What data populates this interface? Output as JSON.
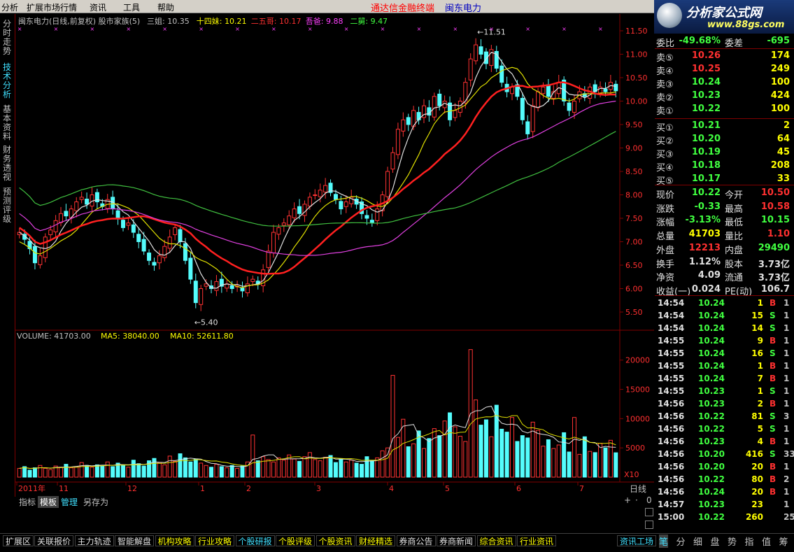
{
  "menu": {
    "items": [
      "分析",
      "扩展市场行情",
      "资讯",
      "工具",
      "帮助"
    ],
    "title": "通达信金融终端",
    "stock": "闽东电力"
  },
  "logo": {
    "main": "分析家公式网",
    "url": "www.88gs.com"
  },
  "side_tabs": [
    "分时走势",
    "技术分析",
    "基本资料",
    "财务透视",
    "预测评级"
  ],
  "chart_header": {
    "name": "闽东电力(日线,前复权) 股市家族(5)",
    "indicators": [
      {
        "label": "三姐: 10.35",
        "color": "#c0c0c0"
      },
      {
        "label": "十四妹: 10.21",
        "color": "#ffff00"
      },
      {
        "label": "二五哥: 10.17",
        "color": "#ff3030"
      },
      {
        "label": "吾爸: 9.88",
        "color": "#ff40ff"
      },
      {
        "label": "二舅: 9.47",
        "color": "#40ff40"
      }
    ]
  },
  "colors": {
    "up": "#ff3232",
    "down": "#54fcfc",
    "ma_white": "#e0e0e0",
    "ma_yellow": "#e0e000",
    "ma_red": "#ff2020",
    "ma_magenta": "#e040e0",
    "ma_green": "#40c040",
    "axis": "#800000"
  },
  "chart_data": {
    "type": "candlestick",
    "price_axis": {
      "ticks": [
        "11.50",
        "11.00",
        "10.50",
        "10.00",
        "9.50",
        "9.00",
        "8.50",
        "8.00",
        "7.50",
        "7.00",
        "6.50",
        "6.00",
        "5.50"
      ],
      "min": 5.5,
      "max": 11.5
    },
    "annotations": {
      "high": "11.51",
      "low": "5.40"
    },
    "x_labels": [
      "2011年",
      "11",
      "12",
      "1",
      "2",
      "3",
      "4",
      "5",
      "6",
      "7"
    ],
    "volume_header": [
      {
        "label": "VOLUME: 41703.00",
        "color": "#c0c0c0"
      },
      {
        "label": "MA5: 38040.00",
        "color": "#ffff00"
      },
      {
        "label": "MA10: 52611.80",
        "color": "#ffff00"
      }
    ],
    "volume_axis": {
      "ticks": [
        "20000",
        "15000",
        "10000",
        "5000"
      ],
      "unit": "X10",
      "max": 22000
    },
    "closes": [
      7.2,
      7.05,
      6.85,
      6.55,
      6.7,
      7.1,
      7.25,
      7.45,
      7.6,
      7.55,
      7.7,
      7.85,
      7.95,
      7.8,
      8.0,
      7.85,
      7.75,
      7.9,
      7.7,
      7.5,
      7.3,
      7.4,
      7.2,
      7.0,
      6.8,
      6.6,
      6.5,
      6.7,
      6.9,
      7.1,
      7.3,
      7.0,
      6.6,
      6.2,
      5.7,
      6.0,
      6.1,
      6.0,
      6.15,
      6.05,
      6.1,
      6.0,
      6.05,
      5.95,
      6.1,
      6.2,
      6.1,
      6.4,
      6.8,
      7.2,
      7.3,
      7.4,
      7.55,
      7.7,
      7.6,
      7.8,
      7.95,
      8.0,
      8.1,
      8.2,
      8.05,
      7.9,
      7.7,
      7.85,
      7.95,
      7.8,
      7.6,
      7.5,
      7.4,
      7.7,
      8.0,
      8.5,
      8.9,
      9.4,
      9.6,
      9.5,
      9.8,
      9.6,
      9.9,
      9.7,
      10.1,
      9.9,
      10.0,
      9.6,
      9.8,
      10.0,
      10.4,
      10.9,
      11.2,
      11.0,
      10.8,
      11.1,
      10.7,
      10.4,
      10.2,
      10.3,
      10.1,
      9.6,
      9.3,
      9.9,
      10.2,
      10.3,
      10.1,
      10.2,
      10.4,
      10.0,
      9.8,
      10.0,
      10.2,
      10.1,
      10.3,
      10.2,
      10.3,
      10.2,
      10.4,
      10.22
    ],
    "volumes": [
      1500,
      1800,
      1200,
      1600,
      2000,
      1500,
      1300,
      1900,
      1700,
      2200,
      1600,
      1800,
      2500,
      2000,
      1700,
      2100,
      1900,
      2600,
      1800,
      2400,
      2000,
      1700,
      2900,
      2300,
      1900,
      2800,
      3200,
      2500,
      2100,
      3600,
      2700,
      4000,
      3300,
      2600,
      3100,
      2400,
      2000,
      1700,
      2200,
      1800,
      1600,
      2000,
      1500,
      1900,
      2600,
      7200,
      2800,
      3500,
      3000,
      2600,
      3300,
      2900,
      3800,
      3100,
      2700,
      3500,
      4200,
      3000,
      2800,
      3400,
      3700,
      2500,
      3100,
      2600,
      2900,
      2400,
      2200,
      3500,
      2800,
      3300,
      4500,
      5000,
      17400,
      6800,
      9900,
      5200,
      5700,
      7900,
      4900,
      6600,
      8300,
      7100,
      9600,
      11000,
      8600,
      7000,
      6100,
      21800,
      13200,
      8900,
      9800,
      6900,
      12300,
      8200,
      7700,
      10200,
      6100,
      7100,
      6700,
      9400,
      8000,
      5300,
      6400,
      4900,
      5500,
      7600,
      4300,
      10200,
      3900,
      6900,
      4400,
      4200,
      5800,
      5000,
      6300,
      4170
    ],
    "ma_lines": {
      "ma_white": {
        "start": 7.2,
        "end": 10.35
      },
      "ma_yellow": {
        "start": 7.0,
        "end": 10.21
      },
      "ma_red": {
        "start": 7.3,
        "end": 10.17
      },
      "ma_magenta": {
        "start": 7.6,
        "end": 9.88
      },
      "ma_green": {
        "start": 8.15,
        "end": 9.47
      }
    }
  },
  "quote": {
    "rows": [
      {
        "l": "委比",
        "v": "-49.68%",
        "l2": "委差",
        "v2": "-695",
        "vc": "#40ff40",
        "v2c": "#40ff40"
      },
      {
        "l": "卖⑤",
        "v": "10.26",
        "v2": "174",
        "vc": "#ff3030",
        "v2c": "#ffff00"
      },
      {
        "l": "卖④",
        "v": "10.25",
        "v2": "249",
        "vc": "#ff3030",
        "v2c": "#ffff00"
      },
      {
        "l": "卖③",
        "v": "10.24",
        "v2": "100",
        "vc": "#40ff40",
        "v2c": "#ffff00"
      },
      {
        "l": "卖②",
        "v": "10.23",
        "v2": "424",
        "vc": "#40ff40",
        "v2c": "#ffff00"
      },
      {
        "l": "卖①",
        "v": "10.22",
        "v2": "100",
        "vc": "#40ff40",
        "v2c": "#ffff00"
      },
      {
        "l": "买①",
        "v": "10.21",
        "v2": "2",
        "vc": "#40ff40",
        "v2c": "#ffff00"
      },
      {
        "l": "买②",
        "v": "10.20",
        "v2": "64",
        "vc": "#40ff40",
        "v2c": "#ffff00"
      },
      {
        "l": "买③",
        "v": "10.19",
        "v2": "45",
        "vc": "#40ff40",
        "v2c": "#ffff00"
      },
      {
        "l": "买④",
        "v": "10.18",
        "v2": "208",
        "vc": "#40ff40",
        "v2c": "#ffff00"
      },
      {
        "l": "买⑤",
        "v": "10.17",
        "v2": "33",
        "vc": "#40ff40",
        "v2c": "#ffff00"
      }
    ],
    "stats": [
      {
        "l": "现价",
        "v": "10.22",
        "l2": "今开",
        "v2": "10.50",
        "vc": "#40ff40",
        "v2c": "#ff3030"
      },
      {
        "l": "涨跌",
        "v": "-0.33",
        "l2": "最高",
        "v2": "10.58",
        "vc": "#40ff40",
        "v2c": "#ff3030"
      },
      {
        "l": "涨幅",
        "v": "-3.13%",
        "l2": "最低",
        "v2": "10.15",
        "vc": "#40ff40",
        "v2c": "#40ff40"
      },
      {
        "l": "总量",
        "v": "41703",
        "l2": "量比",
        "v2": "1.10",
        "vc": "#ffff00",
        "v2c": "#ff3030"
      },
      {
        "l": "外盘",
        "v": "12213",
        "l2": "内盘",
        "v2": "29490",
        "vc": "#ff3030",
        "v2c": "#40ff40"
      },
      {
        "l": "换手",
        "v": "1.12%",
        "l2": "股本",
        "v2": "3.73亿",
        "vc": "#e0e0e0",
        "v2c": "#e0e0e0"
      },
      {
        "l": "净资",
        "v": "4.09",
        "l2": "流通",
        "v2": "3.73亿",
        "vc": "#e0e0e0",
        "v2c": "#e0e0e0"
      },
      {
        "l": "收益(一)",
        "v": "0.024",
        "l2": "PE(动)",
        "v2": "106.7",
        "vc": "#e0e0e0",
        "v2c": "#e0e0e0"
      }
    ]
  },
  "trades": [
    {
      "t": "14:54",
      "p": "10.24",
      "q": "1",
      "bs": "B",
      "n": "1"
    },
    {
      "t": "14:54",
      "p": "10.24",
      "q": "15",
      "bs": "S",
      "n": "1"
    },
    {
      "t": "14:54",
      "p": "10.24",
      "q": "14",
      "bs": "S",
      "n": "1"
    },
    {
      "t": "14:55",
      "p": "10.24",
      "q": "9",
      "bs": "B",
      "n": "1"
    },
    {
      "t": "14:55",
      "p": "10.24",
      "q": "16",
      "bs": "S",
      "n": "1"
    },
    {
      "t": "14:55",
      "p": "10.24",
      "q": "1",
      "bs": "B",
      "n": "1"
    },
    {
      "t": "14:55",
      "p": "10.24",
      "q": "7",
      "bs": "B",
      "n": "1"
    },
    {
      "t": "14:55",
      "p": "10.23",
      "q": "1",
      "bs": "S",
      "n": "1"
    },
    {
      "t": "14:56",
      "p": "10.23",
      "q": "2",
      "bs": "B",
      "n": "1"
    },
    {
      "t": "14:56",
      "p": "10.22",
      "q": "81",
      "bs": "S",
      "n": "3"
    },
    {
      "t": "14:56",
      "p": "10.22",
      "q": "5",
      "bs": "S",
      "n": "1"
    },
    {
      "t": "14:56",
      "p": "10.23",
      "q": "4",
      "bs": "B",
      "n": "1"
    },
    {
      "t": "14:56",
      "p": "10.20",
      "q": "416",
      "bs": "S",
      "n": "33"
    },
    {
      "t": "14:56",
      "p": "10.20",
      "q": "20",
      "bs": "B",
      "n": "1"
    },
    {
      "t": "14:56",
      "p": "10.22",
      "q": "80",
      "bs": "B",
      "n": "2"
    },
    {
      "t": "14:56",
      "p": "10.24",
      "q": "20",
      "bs": "B",
      "n": "1"
    },
    {
      "t": "14:57",
      "p": "10.23",
      "q": "23",
      "bs": "",
      "n": "1"
    },
    {
      "t": "15:00",
      "p": "10.22",
      "q": "260",
      "bs": "",
      "n": "25"
    }
  ],
  "sub_tabs": [
    "指标",
    "模板",
    "管理",
    "另存为"
  ],
  "bottom_tabs": [
    "扩展区",
    "关联报价",
    "主力轨迹",
    "智能解盘",
    "机构攻略",
    "行业攻略",
    "个股研报",
    "个股评级",
    "个股资讯",
    "财经精选",
    "券商公告",
    "券商新闻",
    "综合资讯",
    "行业资讯",
    "资讯工场"
  ],
  "right_tabs": [
    "笔",
    "分",
    "细",
    "盘",
    "势",
    "指",
    "值",
    "筹"
  ],
  "right_ctrl": {
    "label": "日线",
    "plus": "+",
    "dot": "·",
    "zero": "0"
  }
}
